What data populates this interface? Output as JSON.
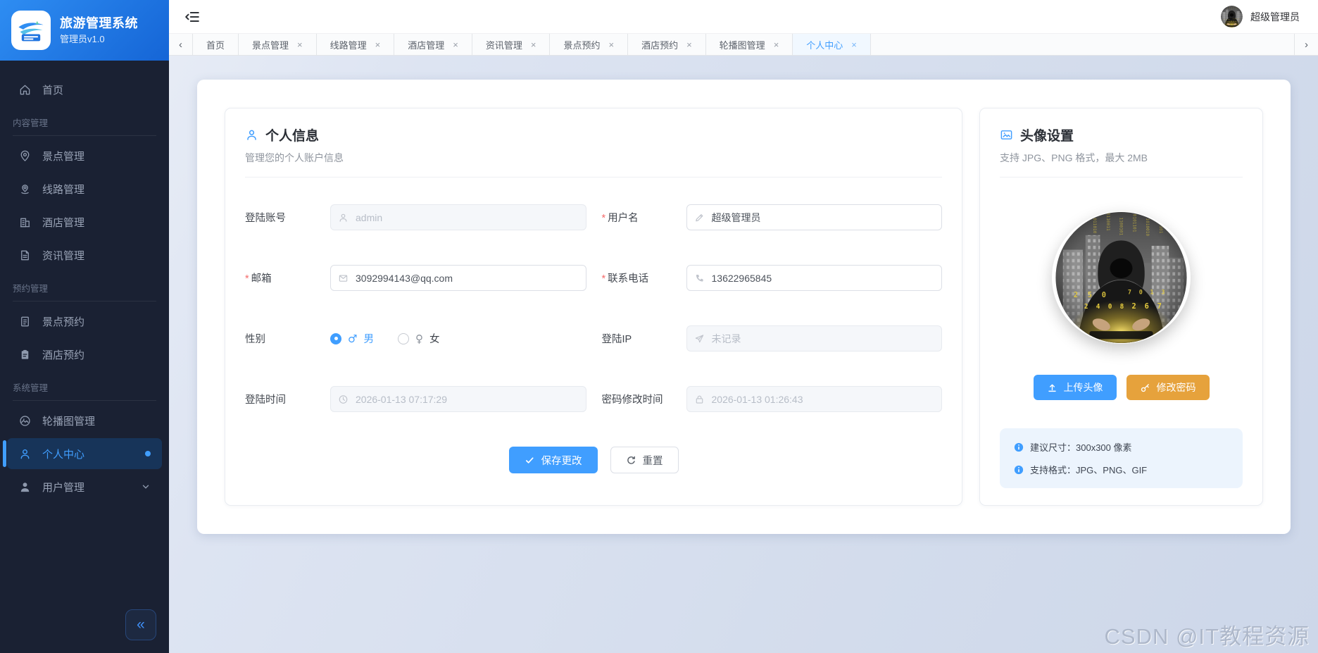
{
  "colors": {
    "accent": "#409eff",
    "warning": "#e6a23c",
    "danger": "#f56c6c",
    "sidebar_bg": "#1a2133",
    "brand_gradient": [
      "#2e8df2",
      "#1565d6"
    ],
    "page_bg": "#d3dcec"
  },
  "brand": {
    "title": "旅游管理系统",
    "subtitle": "管理员v1.0"
  },
  "sidebar": {
    "sections": [
      {
        "label": "内容管理"
      },
      {
        "label": "预约管理"
      },
      {
        "label": "系统管理"
      }
    ],
    "items": [
      {
        "label": "首页"
      },
      {
        "label": "景点管理"
      },
      {
        "label": "线路管理"
      },
      {
        "label": "酒店管理"
      },
      {
        "label": "资讯管理"
      },
      {
        "label": "景点预约"
      },
      {
        "label": "酒店预约"
      },
      {
        "label": "轮播图管理"
      },
      {
        "label": "个人中心",
        "active": true
      },
      {
        "label": "用户管理"
      }
    ],
    "collapse_icon": "«"
  },
  "header": {
    "username": "超级管理员"
  },
  "tabbar": {
    "prev": "‹",
    "next": "›",
    "close": "×",
    "tabs": [
      {
        "label": "首页",
        "closable": false
      },
      {
        "label": "景点管理",
        "closable": true
      },
      {
        "label": "线路管理",
        "closable": true
      },
      {
        "label": "酒店管理",
        "closable": true
      },
      {
        "label": "资讯管理",
        "closable": true
      },
      {
        "label": "景点预约",
        "closable": true
      },
      {
        "label": "酒店预约",
        "closable": true
      },
      {
        "label": "轮播图管理",
        "closable": true
      },
      {
        "label": "个人中心",
        "closable": true,
        "active": true
      }
    ]
  },
  "profile": {
    "title": "个人信息",
    "subtitle": "管理您的个人账户信息",
    "required_mark": "*",
    "fields": {
      "account": {
        "label": "登陆账号",
        "value": "admin",
        "disabled": true
      },
      "username": {
        "label": "用户名",
        "value": "超级管理员",
        "required": true
      },
      "email": {
        "label": "邮箱",
        "value": "3092994143@qq.com",
        "required": true
      },
      "phone": {
        "label": "联系电话",
        "value": "13622965845",
        "required": true
      },
      "gender": {
        "label": "性别",
        "male": "男",
        "female": "女",
        "male_symbol": "♂",
        "female_symbol": "♀",
        "selected": "男"
      },
      "login_ip": {
        "label": "登陆IP",
        "value": "未记录",
        "disabled": true
      },
      "login_time": {
        "label": "登陆时间",
        "value": "2026-01-13 07:17:29",
        "disabled": true
      },
      "pwd_time": {
        "label": "密码修改时间",
        "value": "2026-01-13 01:26:43",
        "disabled": true
      }
    },
    "save_label": "保存更改",
    "reset_label": "重置"
  },
  "avatar_card": {
    "title": "头像设置",
    "subtitle": "支持 JPG、PNG 格式，最大 2MB",
    "upload_label": "上传头像",
    "password_label": "修改密码",
    "tips": [
      {
        "text": "建议尺寸：300x300 像素"
      },
      {
        "text": "支持格式：JPG、PNG、GIF"
      }
    ]
  },
  "watermark": "CSDN @IT教程资源"
}
